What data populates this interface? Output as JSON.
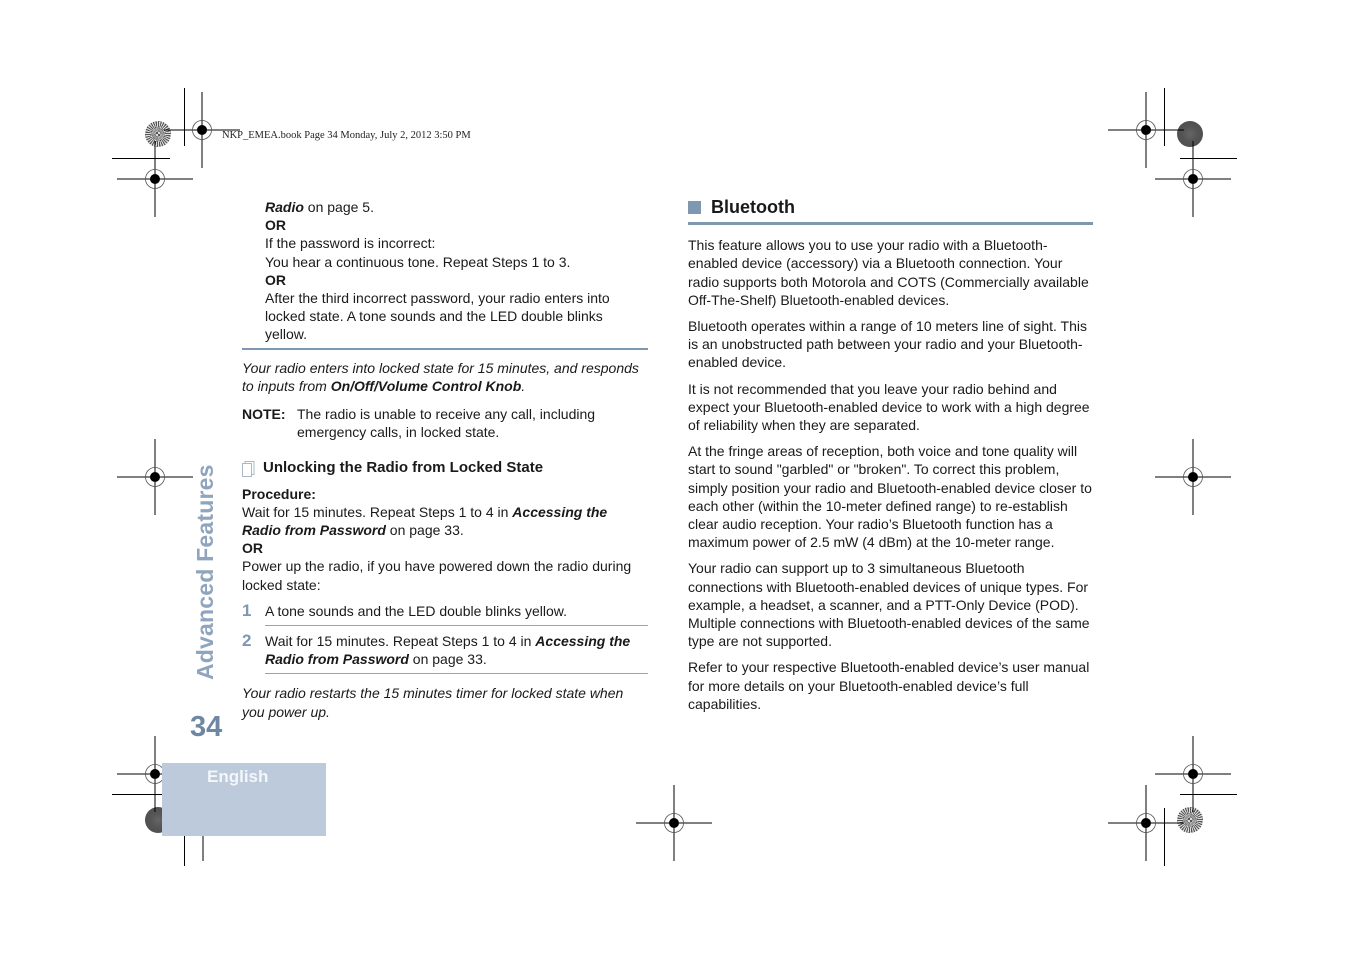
{
  "print_header": "NKP_EMEA.book  Page 34  Monday, July 2, 2012  3:50 PM",
  "side_tab": {
    "chapter": "Advanced Features",
    "page_number": "34",
    "language": "English"
  },
  "colors": {
    "accent": "#7f98b2",
    "side_title": "#8fa5bd",
    "page_number": "#6e87a3",
    "language_box": "#bccadb"
  },
  "left": {
    "cont_link": "Radio",
    "cont_rest": " on page 5.",
    "or1": "OR",
    "incorrect_label": "If the password is incorrect:",
    "incorrect_text": "You hear a continuous tone. Repeat Steps 1 to 3.",
    "or2": "OR",
    "third_attempt": "After the third incorrect password, your radio enters into locked state. A tone sounds and the LED double blinks yellow.",
    "locked_note_pre": "Your radio enters into locked state for 15 minutes, and responds to inputs from ",
    "locked_note_bold": "On/Off/Volume Control Knob",
    "locked_note_post": ".",
    "note_label": "NOTE:",
    "note_text": "The radio is unable to receive any call, including emergency calls, in locked state.",
    "subheading": "Unlocking the Radio from Locked State",
    "procedure_label": "Procedure:",
    "wait_pre": "Wait for 15 minutes. Repeat Steps 1 to 4 in ",
    "wait_link": "Accessing the Radio from Password",
    "wait_post": " on page 33.",
    "or3": "OR",
    "power_up": "Power up the radio, if you have powered down the radio during locked state:",
    "steps": [
      {
        "num": "1",
        "text": "A tone sounds and the LED double blinks yellow."
      },
      {
        "num": "2",
        "pre": "Wait for 15 minutes. Repeat Steps 1 to 4 in ",
        "link": "Accessing the Radio from Password",
        "post": " on page 33."
      }
    ],
    "restart_note": "Your radio restarts the 15 minutes timer for locked state when you power up."
  },
  "right": {
    "heading": "Bluetooth",
    "paragraphs": [
      "This feature allows you to use your radio with a Bluetooth-enabled device (accessory) via a Bluetooth connection. Your radio supports both Motorola and COTS (Commercially available Off-The-Shelf) Bluetooth-enabled devices.",
      "Bluetooth operates within a range of 10 meters line of sight. This is an unobstructed path between your radio and your Bluetooth-enabled device.",
      "It is not recommended that you leave your radio behind and expect your Bluetooth-enabled device to work with a high degree of reliability when they are separated.",
      "At the fringe areas of reception, both voice and tone quality will start to sound \"garbled\" or \"broken\". To correct this problem, simply position your radio and Bluetooth-enabled device closer to each other (within the 10-meter defined range) to re-establish clear audio reception. Your radio’s Bluetooth function has a maximum power of 2.5 mW (4 dBm) at the 10-meter range.",
      "Your radio can support up to 3 simultaneous Bluetooth connections with Bluetooth-enabled devices of unique types. For example, a headset, a scanner, and a PTT-Only Device (POD). Multiple connections with Bluetooth-enabled devices of the same type are not supported.",
      "Refer to your respective Bluetooth-enabled device’s user manual for more details on your Bluetooth-enabled device’s full capabilities."
    ]
  }
}
